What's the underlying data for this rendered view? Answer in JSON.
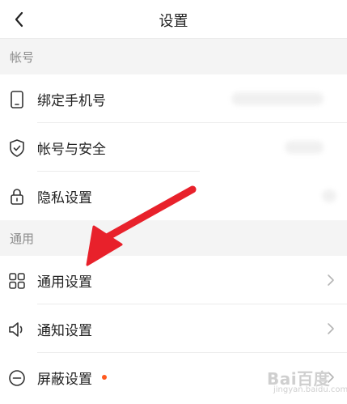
{
  "header": {
    "title": "设置",
    "back_icon": "chevron-left-icon"
  },
  "sections": {
    "account": {
      "title": "帐号",
      "items": [
        {
          "label": "绑定手机号",
          "icon": "phone-icon"
        },
        {
          "label": "帐号与安全",
          "icon": "shield-check-icon"
        },
        {
          "label": "隐私设置",
          "icon": "lock-icon"
        }
      ]
    },
    "general": {
      "title": "通用",
      "items": [
        {
          "label": "通用设置",
          "icon": "grid-icon"
        },
        {
          "label": "通知设置",
          "icon": "speaker-icon"
        },
        {
          "label": "屏蔽设置",
          "icon": "block-icon",
          "badge": "red-dot"
        }
      ]
    }
  },
  "annotation": {
    "type": "arrow",
    "color": "#e8212b",
    "points_to": "通用设置"
  },
  "watermark": {
    "brand": "Bai百度",
    "sub": "jingyan.baidu.com"
  },
  "colors": {
    "section_bg": "#f4f4f4",
    "badge": "#ff5a1f",
    "arrow": "#e8212b"
  }
}
